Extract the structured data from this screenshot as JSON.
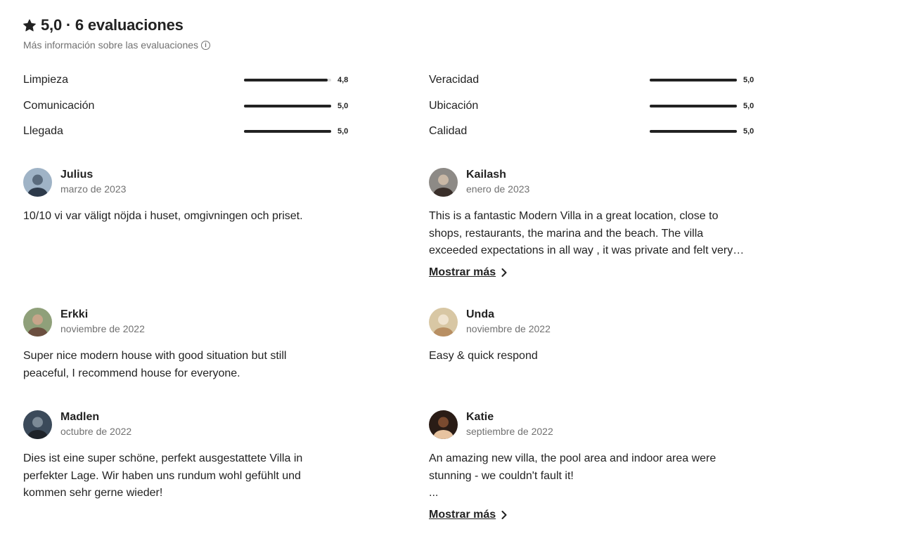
{
  "header": {
    "title": "5,0 · 6 evaluaciones",
    "info_link": "Más información sobre las evaluaciones"
  },
  "ratings": [
    {
      "label": "Limpieza",
      "value_text": "4,8",
      "value": 4.8
    },
    {
      "label": "Comunicación",
      "value_text": "5,0",
      "value": 5.0
    },
    {
      "label": "Llegada",
      "value_text": "5,0",
      "value": 5.0
    },
    {
      "label": "Veracidad",
      "value_text": "5,0",
      "value": 5.0
    },
    {
      "label": "Ubicación",
      "value_text": "5,0",
      "value": 5.0
    },
    {
      "label": "Calidad",
      "value_text": "5,0",
      "value": 5.0
    }
  ],
  "reviews": [
    {
      "name": "Julius",
      "date": "marzo de 2023",
      "lines": [
        "10/10 vi var väligt nöjda i huset, omgivningen och priset."
      ],
      "show_more": ""
    },
    {
      "name": "Kailash",
      "date": "enero de 2023",
      "lines": [
        "This is a fantastic Modern Villa in a great location, close to",
        "shops, restaurants, the marina and the beach. The villa",
        "exceeded expectations in all way , it was private and felt very…"
      ],
      "show_more": "Mostrar más"
    },
    {
      "name": "Erkki",
      "date": "noviembre de 2022",
      "lines": [
        "Super nice modern house with good situation but still",
        "peaceful, I recommend house for everyone."
      ],
      "show_more": ""
    },
    {
      "name": "Unda",
      "date": "noviembre de 2022",
      "lines": [
        "Easy & quick respond"
      ],
      "show_more": ""
    },
    {
      "name": "Madlen",
      "date": "octubre de 2022",
      "lines": [
        "Dies ist eine super schöne, perfekt ausgestattete Villa in",
        "perfekter Lage. Wir haben uns rundum wohl gefühlt und",
        "kommen sehr gerne wieder!"
      ],
      "show_more": ""
    },
    {
      "name": "Katie",
      "date": "septiembre de 2022",
      "lines": [
        "An amazing new villa, the pool area and indoor area were",
        "stunning - we couldn't fault it!",
        "..."
      ],
      "show_more": "Mostrar más"
    }
  ],
  "icons": {
    "star": "star-icon",
    "info": "info-icon",
    "chevron": "chevron-right-icon"
  },
  "colors": {
    "text": "#222222",
    "muted": "#717171",
    "bar_fill": "#222222",
    "bar_track": "#dddddd"
  }
}
